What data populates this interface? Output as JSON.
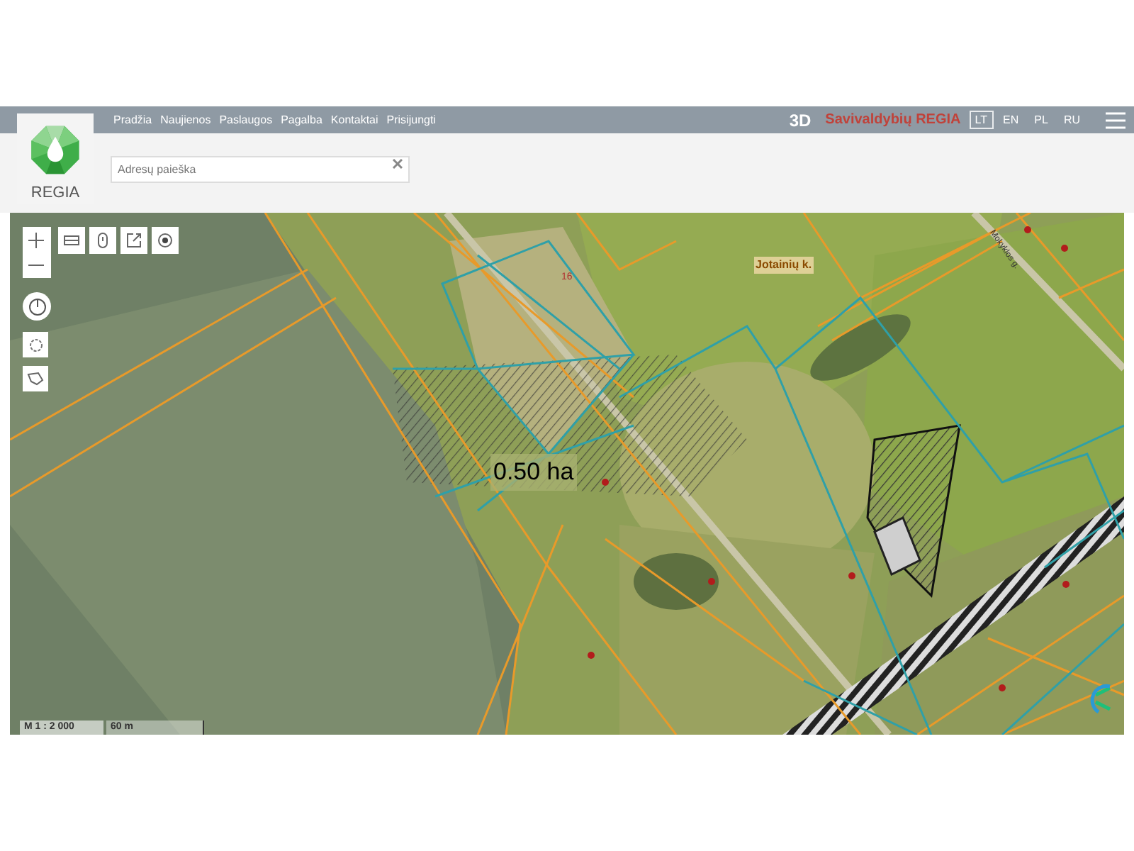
{
  "nav": {
    "items": [
      "Pradžia",
      "Naujienos",
      "Paslaugos",
      "Pagalba",
      "Kontaktai",
      "Prisijungti"
    ]
  },
  "logo": {
    "text": "REGIA"
  },
  "search": {
    "placeholder": "Adresų paieška"
  },
  "header_right": {
    "mode": "3D",
    "title": "Savivaldybių REGIA",
    "languages": [
      {
        "label": "LT",
        "selected": true
      },
      {
        "label": "EN",
        "selected": false
      },
      {
        "label": "PL",
        "selected": false
      },
      {
        "label": "RU",
        "selected": false
      }
    ]
  },
  "map": {
    "labels": [
      {
        "text": "Jotainių k.",
        "kind": "place"
      },
      {
        "text": "16",
        "kind": "number"
      },
      {
        "text": "Mokyklos g.",
        "kind": "street"
      },
      {
        "text": "0.50 ha",
        "kind": "area"
      }
    ],
    "scale": {
      "ratio": "M 1 : 2 000",
      "distance": "60 m"
    }
  }
}
